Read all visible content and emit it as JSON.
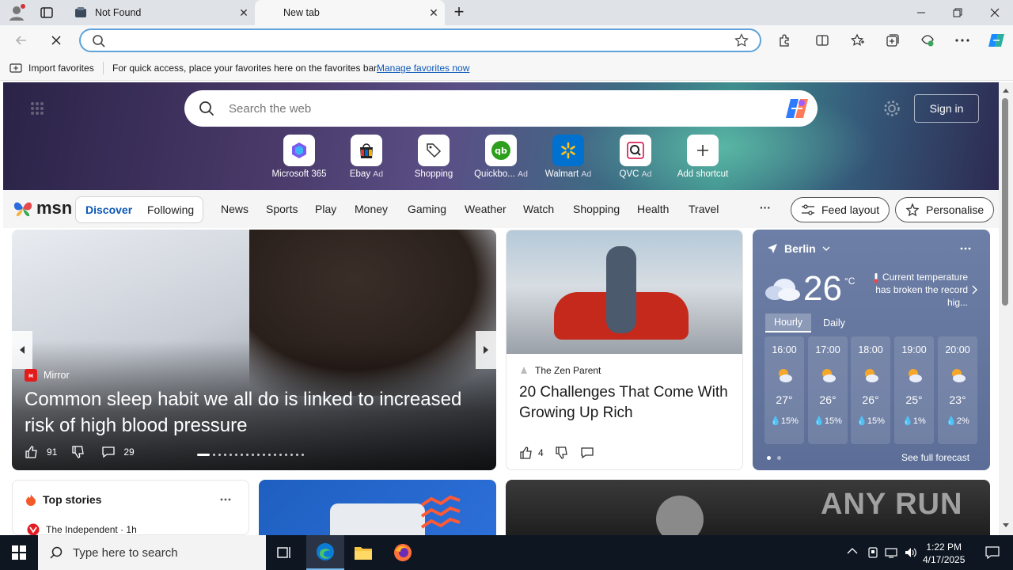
{
  "tabs": [
    {
      "title": "Not Found",
      "close": "✕"
    },
    {
      "title": "New tab",
      "close": "✕"
    }
  ],
  "new_tab_symbol": "+",
  "window_controls": {
    "minimize": "—",
    "maximize": "❐",
    "close": "✕"
  },
  "address": {
    "value": "",
    "placeholder": ""
  },
  "favorites_bar": {
    "import_label": "Import favorites",
    "message": "For quick access, place your favorites here on the favorites bar.",
    "manage_link": "Manage favorites now"
  },
  "hero": {
    "search_placeholder": "Search the web",
    "sign_in": "Sign in",
    "shortcuts": [
      {
        "label": "Microsoft 365",
        "ad": "",
        "icon": "m365-icon"
      },
      {
        "label": "Ebay",
        "ad": "Ad",
        "icon": "ebay-icon"
      },
      {
        "label": "Shopping",
        "ad": "",
        "icon": "tag-icon"
      },
      {
        "label": "Quickbo...",
        "ad": "Ad",
        "icon": "quickbooks-icon"
      },
      {
        "label": "Walmart",
        "ad": "Ad",
        "icon": "walmart-icon"
      },
      {
        "label": "QVC",
        "ad": "Ad",
        "icon": "qvc-icon"
      },
      {
        "label": "Add shortcut",
        "ad": "",
        "icon": "plus-icon"
      }
    ]
  },
  "msn": {
    "logo": "msn",
    "pill": [
      "Discover",
      "Following"
    ],
    "nav": [
      "News",
      "Sports",
      "Play",
      "Money",
      "Gaming",
      "Weather",
      "Watch",
      "Shopping",
      "Health",
      "Travel"
    ],
    "more": "···",
    "feed_layout": "Feed layout",
    "personalise": "Personalise"
  },
  "main_story": {
    "source": "Mirror",
    "title": "Common sleep habit we all do is linked to increased risk of high blood pressure",
    "likes": "91",
    "comments": "29"
  },
  "story2": {
    "source": "The Zen Parent",
    "title": "20 Challenges That Come With Growing Up Rich",
    "likes": "4"
  },
  "weather": {
    "city": "Berlin",
    "temp": "26",
    "unit": "°C",
    "note": "Current temperature has broken the record hig...",
    "tabs": [
      "Hourly",
      "Daily"
    ],
    "hours": [
      {
        "time": "16:00",
        "temp": "27°",
        "rain": "15%"
      },
      {
        "time": "17:00",
        "temp": "26°",
        "rain": "15%"
      },
      {
        "time": "18:00",
        "temp": "26°",
        "rain": "15%"
      },
      {
        "time": "19:00",
        "temp": "25°",
        "rain": "1%"
      },
      {
        "time": "20:00",
        "temp": "23°",
        "rain": "2%"
      }
    ],
    "forecast_link": "See full forecast"
  },
  "top_stories": {
    "title": "Top stories",
    "source": "The Independent · 1h"
  },
  "watermark": "ANY RUN",
  "taskbar": {
    "search_placeholder": "Type here to search",
    "time": "1:22 PM",
    "date": "4/17/2025"
  },
  "colors": {
    "accent": "#0b57b8",
    "address_border": "#5ea3db",
    "taskbar": "#0e1622",
    "weather_card": "#6d7fa6"
  }
}
